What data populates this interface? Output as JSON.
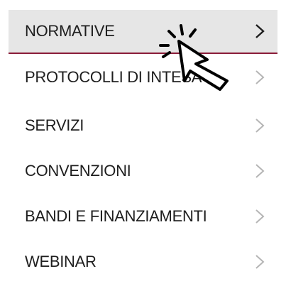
{
  "menu": {
    "items": [
      {
        "label": "NORMATIVE",
        "active": true
      },
      {
        "label": "PROTOCOLLI DI INTESA",
        "active": false
      },
      {
        "label": "SERVIZI",
        "active": false
      },
      {
        "label": "CONVENZIONI",
        "active": false
      },
      {
        "label": "BANDI E FINANZIAMENTI",
        "active": false
      },
      {
        "label": "WEBINAR",
        "active": false
      }
    ],
    "chevron_icon": "chevron-right-icon"
  },
  "colors": {
    "active_background": "#e6e6e6",
    "active_underline": "#8a1c38",
    "text": "#1e1e1e",
    "chevron_active": "#1e1e1e",
    "chevron_inactive": "#b5b5b5"
  },
  "cursor": {
    "icon": "click-pointer-icon"
  }
}
